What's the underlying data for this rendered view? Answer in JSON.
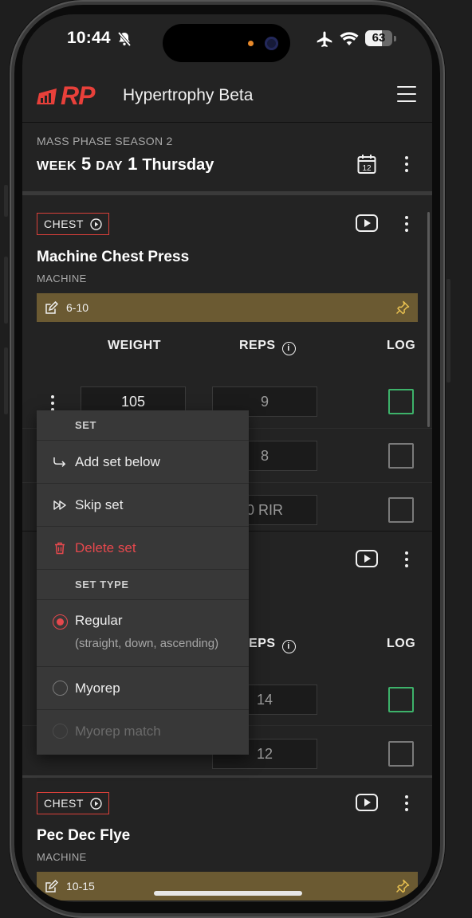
{
  "status_bar": {
    "time": "10:44",
    "battery": "63",
    "battery_level": 0.63
  },
  "app": {
    "logo_text": "RP",
    "title": "Hypertrophy Beta"
  },
  "workout": {
    "phase": "MASS PHASE SEASON 2",
    "week_label": "WEEK",
    "week_num": "5",
    "day_label": "DAY",
    "day_num": "1",
    "day_name": "Thursday",
    "calendar_day": "12"
  },
  "columns": {
    "weight": "WEIGHT",
    "reps": "REPS",
    "log": "LOG"
  },
  "exercises": [
    {
      "muscle": "CHEST",
      "name": "Machine Chest Press",
      "equipment": "MACHINE",
      "note": "6-10",
      "sets": [
        {
          "weight": "105",
          "reps": "9",
          "logged": true
        },
        {
          "weight": "",
          "reps": "8",
          "logged": false
        },
        {
          "weight": "",
          "reps": "0 RIR",
          "logged": false
        }
      ]
    },
    {
      "sets": [
        {
          "reps": "14",
          "logged": true
        },
        {
          "reps": "12",
          "logged": false
        }
      ]
    },
    {
      "muscle": "CHEST",
      "name": "Pec Dec Flye",
      "equipment": "MACHINE",
      "note": "10-15"
    }
  ],
  "menu": {
    "set_header": "SET",
    "add_set_below": "Add set below",
    "skip_set": "Skip set",
    "delete_set": "Delete set",
    "set_type_header": "SET TYPE",
    "regular": "Regular",
    "regular_sub": "(straight, down, ascending)",
    "myorep": "Myorep",
    "myorep_match": "Myorep match",
    "selected_type": "Regular"
  },
  "colors": {
    "accent": "#e8403a",
    "note_bg": "#6b5a32",
    "log_green": "#3db26a",
    "danger": "#e5484d"
  }
}
